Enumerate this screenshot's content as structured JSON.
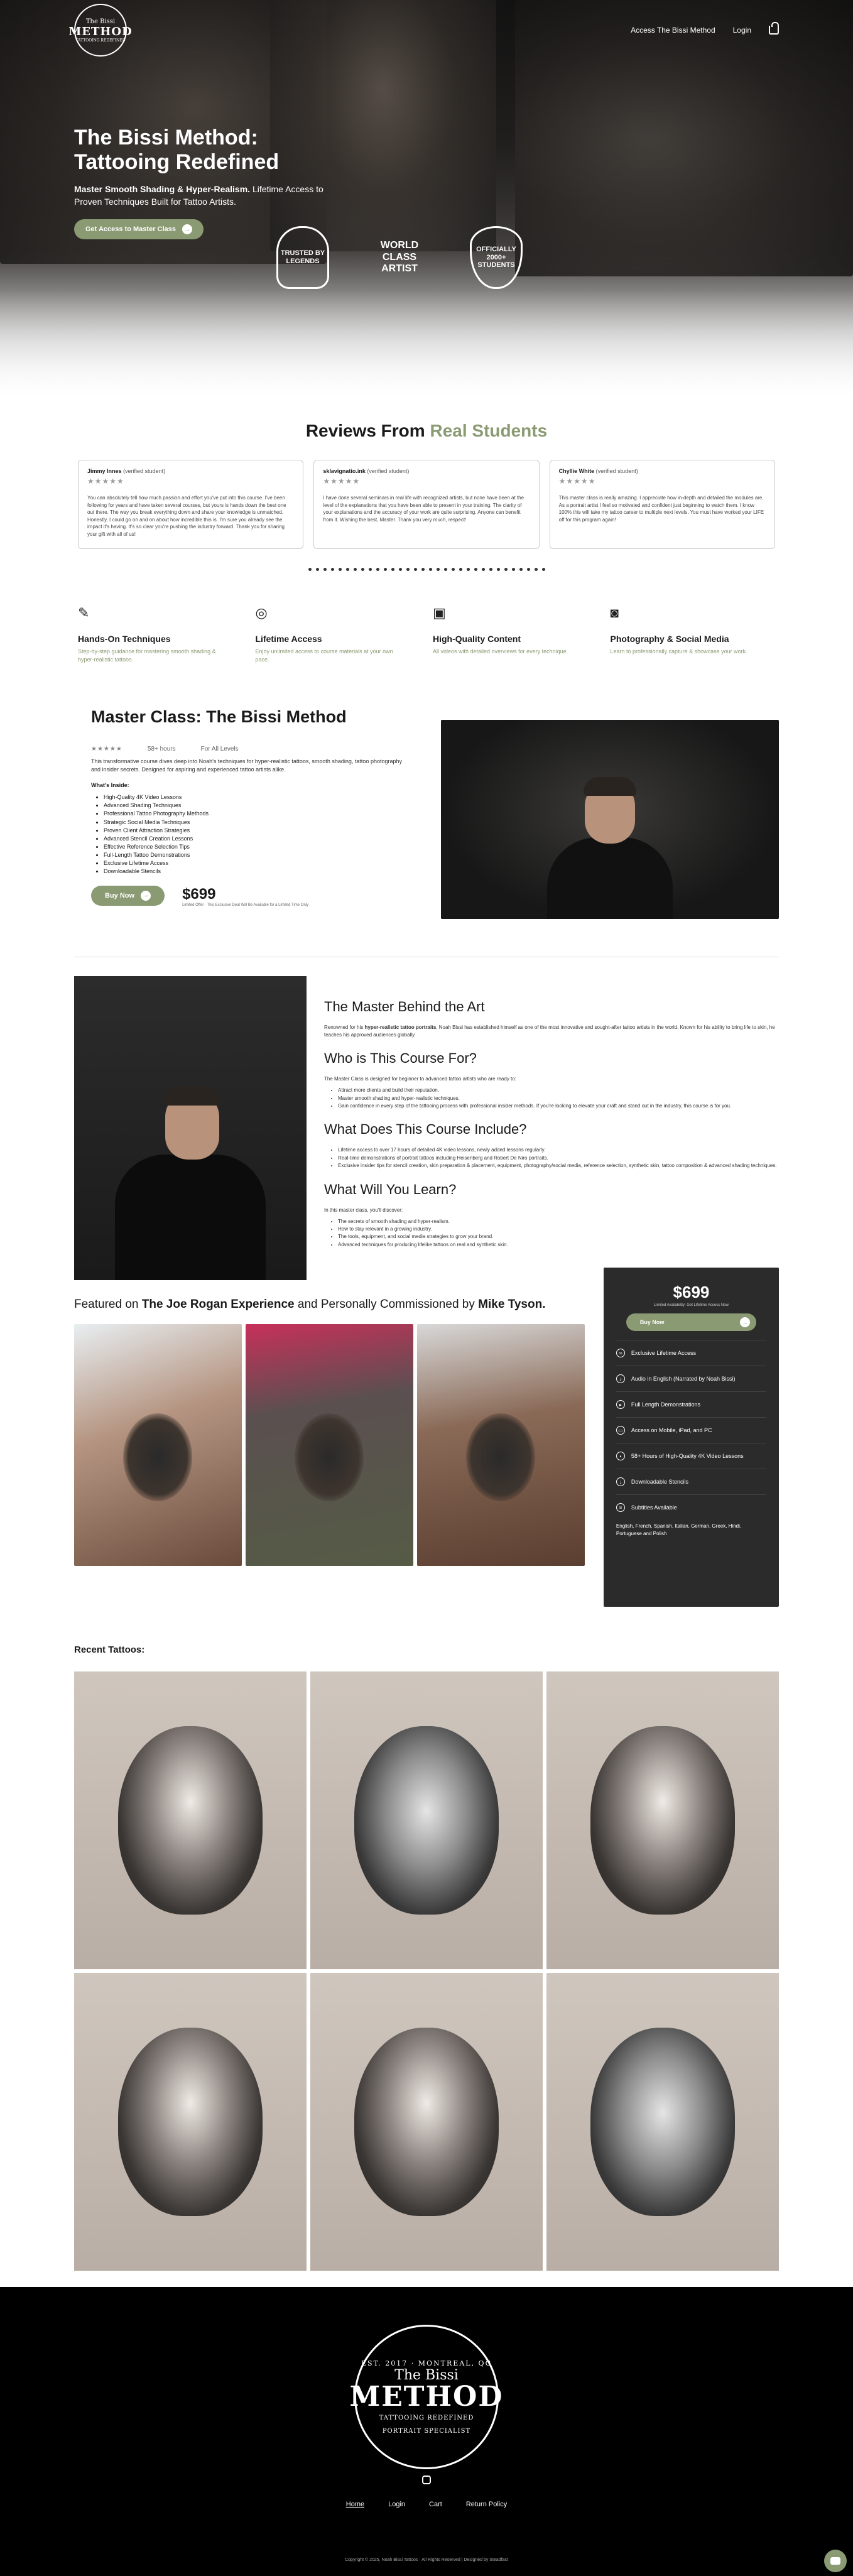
{
  "nav": {
    "logo_small": "The Bissi",
    "logo_main": "METHOD",
    "logo_sub": "TATTOOING REDEFINED",
    "access_link": "Access The Bissi Method",
    "login_link": "Login"
  },
  "hero": {
    "title": "The Bissi Method: Tattooing Redefined",
    "subtitle_bold": "Master Smooth Shading & Hyper-Realism.",
    "subtitle_rest": " Lifetime Access to Proven Techniques Built for Tattoo Artists.",
    "cta": "Get Access to Master Class",
    "badges": [
      "TRUSTED BY LEGENDS",
      "WORLD CLASS ARTIST",
      "OFFICIALLY 2000+ STUDENTS"
    ]
  },
  "reviews": {
    "title_start": "Reviews From ",
    "title_accent": "Real Students",
    "items": [
      {
        "name": "Jimmy Innes",
        "tag": " (verified student)",
        "stars": "★★★★★",
        "text": "You can absolutely tell how much passion and effort you've put into this course. I've been following for years and have taken several courses, but yours is hands down the best one out there. The way you break everything down and share your knowledge is unmatched. Honestly, I could go on and on about how incredible this is. I'm sure you already see the impact it's having. It's so clear you're pushing the industry forward. Thank you for sharing your gift with all of us!"
      },
      {
        "name": "sklavignatio.ink",
        "tag": " (verified student)",
        "stars": "★★★★★",
        "text": "I have done several seminars in real life with recognized artists, but none have been at the level of the explanations that you have been able to present in your training. The clarity of your explanations and the accuracy of your work are quite surprising. Anyone can benefit from it. Wishing the best, Master. Thank you very much, respect!"
      },
      {
        "name": "Chyllie White",
        "tag": " (verified student)",
        "stars": "★★★★★",
        "text": "This master class is really amazing. I appreciate how in-depth and detailed the modules are. As a portrait artist I feel so motivated and confident just beginning to watch them. I know 100% this will take my tattoo career to multiple next levels. You must have worked your LIFE off for this program again!"
      }
    ]
  },
  "features": [
    {
      "title": "Hands-On Techniques",
      "text": "Step-by-step guidance for mastering smooth shading & hyper-realistic tattoos."
    },
    {
      "title": "Lifetime Access",
      "text": "Enjoy unlimited access to course materials at your own pace."
    },
    {
      "title": "High-Quality Content",
      "text": "All videos with detailed overviews for every technique."
    },
    {
      "title": "Photography & Social Media",
      "text": "Learn to professionally capture & showcase your work."
    }
  ],
  "masterclass": {
    "title": "Master Class: The Bissi Method",
    "stars": "★★★★★",
    "hours": "58+ hours",
    "level": "For All Levels",
    "description": "This transformative course dives deep into Noah's techniques for hyper-realistic tattoos, smooth shading, tattoo photography and insider secrets. Designed for aspiring and experienced tattoo artists alike.",
    "inside_label": "What's Inside:",
    "inside": [
      "High-Quality 4K Video Lessons",
      "Advanced Shading Techniques",
      "Professional Tattoo Photography Methods",
      "Strategic Social Media Techniques",
      "Proven Client Attraction Strategies",
      "Advanced Stencil Creation Lessons",
      "Effective Reference Selection Tips",
      "Full-Length Tattoo Demonstrations",
      "Exclusive Lifetime Access",
      "Downloadable Stencils"
    ],
    "buy": "Buy Now",
    "price": "$699",
    "price_note": "Limited Offer · This Exclusive Deal Will Be Available for a Limited Time Only"
  },
  "behind": {
    "h1": "The Master Behind the Art",
    "p1_a": "Renowned for his ",
    "p1_b": "hyper-realistic tattoo portraits",
    "p1_c": ", Noah Bissi has established himself as one of the most innovative and sought-after tattoo artists in the world. Known for his ability to bring life to skin, he teaches his approved audiences globally.",
    "h2": "Who is This Course For?",
    "p2": "The Master Class is designed for beginner to advanced tattoo artists who are ready to:",
    "who": [
      "Attract more clients and build their reputation.",
      "Master smooth shading and hyper-realistic techniques.",
      "Gain confidence in every step of the tattooing process with professional insider methods. If you're looking to elevate your craft and stand out in the industry, this course is for you."
    ],
    "h3": "What Does This Course Include?",
    "includes": [
      "Lifetime access to over 17 hours of detailed 4K video lessons, newly added lessons regularly.",
      "Real-time demonstrations of portrait tattoos including Heisenberg and Robert De Niro portraits.",
      "Exclusive insider tips for stencil creation, skin preparation & placement, equipment, photography/social media, reference selection, synthetic skin, tattoo composition & advanced shading techniques."
    ],
    "h4": "What Will You Learn?",
    "p4": "In this master class, you'll discover:",
    "learn": [
      "The secrets of smooth shading and hyper-realism.",
      "How to stay relevant in a growing industry.",
      "The tools, equipment, and social media strategies to grow your brand.",
      "Advanced techniques for producing lifelike tattoos on real and synthetic skin."
    ]
  },
  "featured": {
    "t1": "Featured on ",
    "t2": "The Joe Rogan Experience",
    "t3": " and Personally Commissioned by ",
    "t4": "Mike Tyson."
  },
  "sidebar": {
    "price": "$699",
    "note": "Limited Availability: Get Lifetime Access Now",
    "buy": "Buy Now",
    "rows": [
      "Exclusive Lifetime Access",
      "Audio in English (Narrated by Noah Bissi)",
      "Full Length Demonstrations",
      "Access on Mobile, iPad, and PC",
      "58+ Hours of High-Quality 4K Video Lessons",
      "Downloadable Stencils",
      "Subtitles Available"
    ],
    "langs": "English, French, Spanish, Italian, German, Greek, Hindi, Portuguese and Polish"
  },
  "recent": {
    "title": "Recent Tattoos:"
  },
  "footer": {
    "est": "EST. 2017 · MONTREAL, QC",
    "logo_a": "The Bissi",
    "logo_b": "METHOD",
    "logo_c": "TATTOOING REDEFINED",
    "logo_d": "PORTRAIT SPECIALIST",
    "links": [
      "Home",
      "Login",
      "Cart",
      "Return Policy"
    ],
    "copyright": "Copyright © 2025, Noah Bissi Tattoos · All Rights Reserved | Designed by Steadfast"
  },
  "colors": {
    "accent": "#8a9a72",
    "dark": "#2b2b2b"
  }
}
